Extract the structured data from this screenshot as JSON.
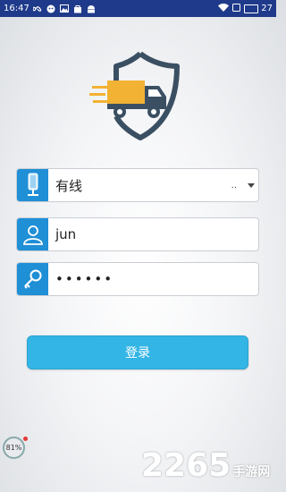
{
  "status_bar": {
    "time": "16:47",
    "battery": "27",
    "icons_left": [
      "infinity-icon",
      "cat-icon",
      "image-icon",
      "bag-icon",
      "android-icon"
    ],
    "icons_right": [
      "wifi-icon",
      "screen-icon",
      "battery-icon"
    ]
  },
  "logo": {
    "icon": "delivery-truck-shield-logo"
  },
  "form": {
    "network": {
      "icon": "network-tower-icon",
      "value": "有线",
      "ellipsis": "..",
      "dropdown_icon": "caret-down-icon"
    },
    "username": {
      "icon": "user-icon",
      "value": "jun"
    },
    "password": {
      "icon": "key-icon",
      "value": "••••••"
    },
    "login_label": "登录"
  },
  "floating_ball": {
    "label": "81%"
  },
  "watermark": {
    "number": "2265",
    "suffix": "手游网"
  },
  "colors": {
    "status_bar": "#1f3a8a",
    "accent": "#1f8fd6",
    "button": "#33b5e5"
  }
}
